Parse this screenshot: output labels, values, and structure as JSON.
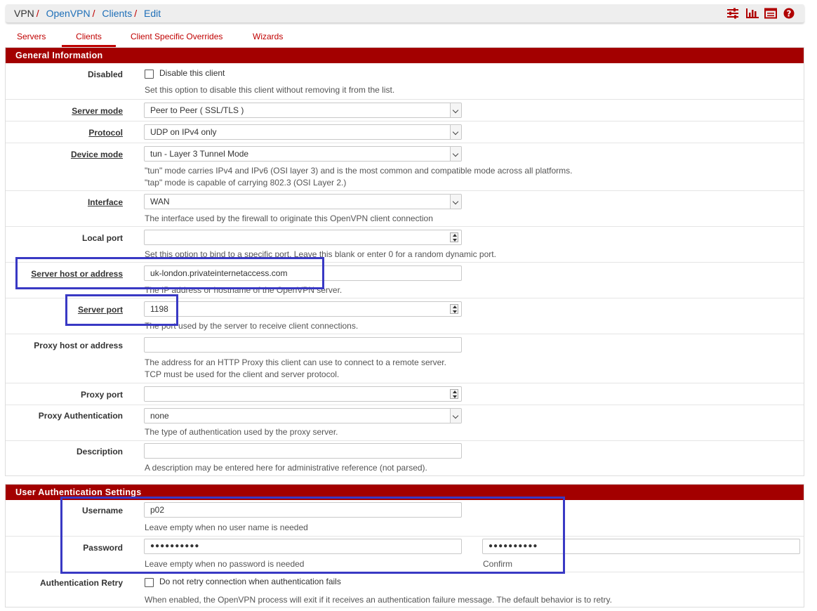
{
  "breadcrumb": [
    "VPN",
    "OpenVPN",
    "Clients",
    "Edit"
  ],
  "toolbar_icons": [
    "settings-sliders-icon",
    "bar-chart-icon",
    "list-icon",
    "help-icon"
  ],
  "tabs": [
    "Servers",
    "Clients",
    "Client Specific Overrides",
    "Wizards"
  ],
  "general": {
    "title": "General Information",
    "disabled": {
      "label": "Disabled",
      "checkbox_label": "Disable this client",
      "help": "Set this option to disable this client without removing it from the list."
    },
    "server_mode": {
      "label": "Server mode",
      "value": "Peer to Peer ( SSL/TLS )"
    },
    "protocol": {
      "label": "Protocol",
      "value": "UDP on IPv4 only"
    },
    "device_mode": {
      "label": "Device mode",
      "value": "tun - Layer 3 Tunnel Mode",
      "help1": "\"tun\" mode carries IPv4 and IPv6 (OSI layer 3) and is the most common and compatible mode across all platforms.",
      "help2": "\"tap\" mode is capable of carrying 802.3 (OSI Layer 2.)"
    },
    "interface": {
      "label": "Interface",
      "value": "WAN",
      "help": "The interface used by the firewall to originate this OpenVPN client connection"
    },
    "local_port": {
      "label": "Local port",
      "value": "",
      "help": "Set this option to bind to a specific port. Leave this blank or enter 0 for a random dynamic port."
    },
    "server_host": {
      "label": "Server host or address",
      "value": "uk-london.privateinternetaccess.com",
      "help": "The IP address or hostname of the OpenVPN server."
    },
    "server_port": {
      "label": "Server port",
      "value": "1198",
      "help": "The port used by the server to receive client connections."
    },
    "proxy_host": {
      "label": "Proxy host or address",
      "value": "",
      "help1": "The address for an HTTP Proxy this client can use to connect to a remote server.",
      "help2": "TCP must be used for the client and server protocol."
    },
    "proxy_port": {
      "label": "Proxy port",
      "value": ""
    },
    "proxy_auth": {
      "label": "Proxy Authentication",
      "value": "none",
      "help": "The type of authentication used by the proxy server."
    },
    "description": {
      "label": "Description",
      "value": "",
      "help": "A description may be entered here for administrative reference (not parsed)."
    }
  },
  "user_auth": {
    "title": "User Authentication Settings",
    "username": {
      "label": "Username",
      "value": "p02",
      "help": "Leave empty when no user name is needed"
    },
    "password": {
      "label": "Password",
      "value": "●●●●●●●●●●",
      "confirm_value": "●●●●●●●●●●",
      "help": "Leave empty when no password is needed",
      "confirm_label": "Confirm"
    },
    "auth_retry": {
      "label": "Authentication Retry",
      "checkbox_label": "Do not retry connection when authentication fails",
      "help": "When enabled, the OpenVPN process will exit if it receives an authentication failure message. The default behavior is to retry."
    }
  },
  "colors": {
    "accent": "#a30000",
    "link": "#1e6fb8",
    "highlight": "#3939c4"
  }
}
